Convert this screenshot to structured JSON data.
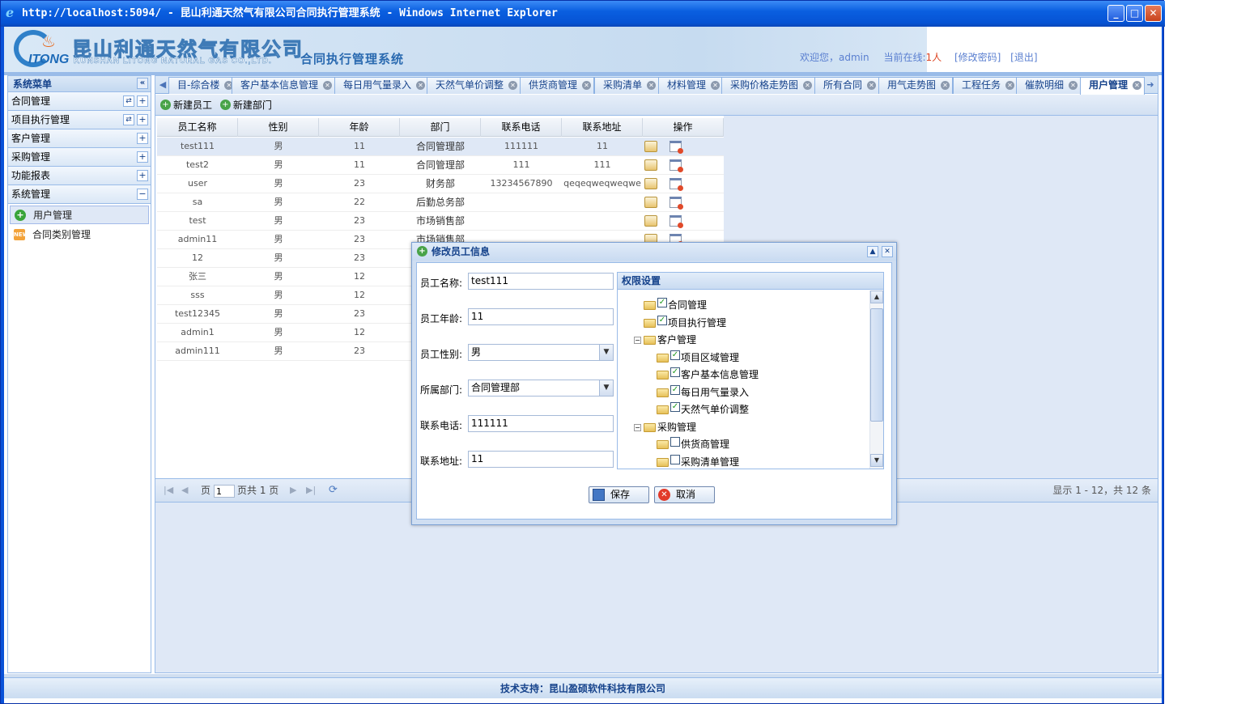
{
  "window": {
    "title": "http://localhost:5094/ - 昆山利通天然气有限公司合同执行管理系统 - Windows Internet Explorer"
  },
  "header": {
    "company_cn": "昆山利通天然气有限公司",
    "company_en": "KUNSHAN LITONG NATURAL GAS CO.,LTD.",
    "logo_text": "ITONG",
    "system_name": "合同执行管理系统",
    "welcome_prefix": "欢迎您，",
    "user": "admin",
    "online_prefix": "当前在线:",
    "online_count": "1人",
    "change_password": "[修改密码]",
    "logout": "[退出]"
  },
  "sidebar": {
    "title": "系统菜单",
    "collapse_icon": "double-chevron-left-icon",
    "groups": [
      {
        "label": "合同管理"
      },
      {
        "label": "项目执行管理"
      },
      {
        "label": "客户管理"
      },
      {
        "label": "采购管理"
      },
      {
        "label": "功能报表"
      },
      {
        "label": "系统管理"
      }
    ],
    "sub_items": [
      {
        "label": "用户管理",
        "icon": "add-circle-icon"
      },
      {
        "label": "合同类别管理",
        "icon": "new-badge-icon",
        "badge": "NEW"
      }
    ]
  },
  "tabs": [
    {
      "label": "目-综合楼"
    },
    {
      "label": "客户基本信息管理"
    },
    {
      "label": "每日用气量录入"
    },
    {
      "label": "天然气单价调整"
    },
    {
      "label": "供货商管理"
    },
    {
      "label": "采购清单"
    },
    {
      "label": "材料管理"
    },
    {
      "label": "采购价格走势图"
    },
    {
      "label": "所有合同"
    },
    {
      "label": "用气走势图"
    },
    {
      "label": "工程任务"
    },
    {
      "label": "催款明细"
    },
    {
      "label": "用户管理"
    }
  ],
  "toolbar": {
    "new_employee": "新建员工",
    "new_department": "新建部门"
  },
  "grid": {
    "columns": [
      "员工名称",
      "性别",
      "年龄",
      "部门",
      "联系电话",
      "联系地址",
      "操作"
    ],
    "rows": [
      [
        "test111",
        "男",
        "11",
        "合同管理部",
        "111111",
        "11"
      ],
      [
        "test2",
        "男",
        "11",
        "合同管理部",
        "111",
        "111"
      ],
      [
        "user",
        "男",
        "23",
        "财务部",
        "13234567890",
        "qeqeqweqweqwe"
      ],
      [
        "sa",
        "男",
        "22",
        "后勤总务部",
        "",
        ""
      ],
      [
        "test",
        "男",
        "23",
        "市场销售部",
        "",
        ""
      ],
      [
        "admin11",
        "男",
        "23",
        "市场销售部",
        "",
        ""
      ],
      [
        "12",
        "男",
        "23",
        "",
        "",
        ""
      ],
      [
        "张三",
        "男",
        "12",
        "",
        "",
        ""
      ],
      [
        "sss",
        "男",
        "12",
        "",
        "",
        ""
      ],
      [
        "test12345",
        "男",
        "23",
        "",
        "",
        ""
      ],
      [
        "admin1",
        "男",
        "12",
        "",
        "",
        ""
      ],
      [
        "admin111",
        "男",
        "23",
        "",
        "",
        ""
      ]
    ]
  },
  "pager": {
    "page_label": "页",
    "page_value": "1",
    "total_label": "页共 1 页",
    "info": "显示 1 - 12，共 12 条"
  },
  "footer": {
    "text": "技术支持：昆山盈硕软件科技有限公司"
  },
  "dialog": {
    "title": "修改员工信息",
    "fields": {
      "name_label": "员工名称:",
      "name_value": "test111",
      "age_label": "员工年龄:",
      "age_value": "11",
      "gender_label": "员工性别:",
      "gender_value": "男",
      "dept_label": "所属部门:",
      "dept_value": "合同管理部",
      "phone_label": "联系电话:",
      "phone_value": "111111",
      "addr_label": "联系地址:",
      "addr_value": "11"
    },
    "permissions": {
      "title": "权限设置",
      "nodes": [
        {
          "label": "合同管理",
          "checked": true
        },
        {
          "label": "项目执行管理",
          "checked": true
        },
        {
          "label": "客户管理",
          "group": true
        },
        {
          "label": "项目区域管理",
          "checked": true
        },
        {
          "label": "客户基本信息管理",
          "checked": true
        },
        {
          "label": "每日用气量录入",
          "checked": true
        },
        {
          "label": "天然气单价调整",
          "checked": true
        },
        {
          "label": "采购管理",
          "group": true
        },
        {
          "label": "供货商管理",
          "checked": false
        },
        {
          "label": "采购清单管理",
          "checked": false
        }
      ]
    },
    "save": "保存",
    "cancel": "取消"
  }
}
